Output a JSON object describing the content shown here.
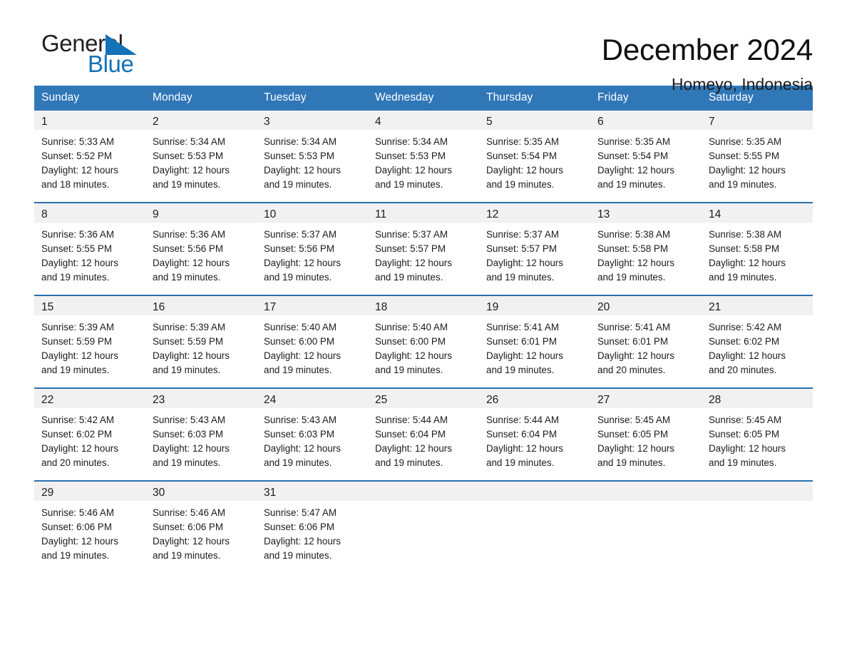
{
  "brand": {
    "logo_text_1": "General",
    "logo_text_2": "Blue",
    "logo_icon": "triangle-icon",
    "accent_color": "#1372b8",
    "header_color": "#3077b8",
    "daynum_band_color": "#f1f1f1"
  },
  "header": {
    "title": "December 2024",
    "location": "Homeyo, Indonesia"
  },
  "calendar": {
    "weekday_headers": [
      "Sunday",
      "Monday",
      "Tuesday",
      "Wednesday",
      "Thursday",
      "Friday",
      "Saturday"
    ],
    "weeks": [
      [
        {
          "day": "1",
          "sunrise": "Sunrise: 5:33 AM",
          "sunset": "Sunset: 5:52 PM",
          "daylight_line1": "Daylight: 12 hours",
          "daylight_line2": "and 18 minutes."
        },
        {
          "day": "2",
          "sunrise": "Sunrise: 5:34 AM",
          "sunset": "Sunset: 5:53 PM",
          "daylight_line1": "Daylight: 12 hours",
          "daylight_line2": "and 19 minutes."
        },
        {
          "day": "3",
          "sunrise": "Sunrise: 5:34 AM",
          "sunset": "Sunset: 5:53 PM",
          "daylight_line1": "Daylight: 12 hours",
          "daylight_line2": "and 19 minutes."
        },
        {
          "day": "4",
          "sunrise": "Sunrise: 5:34 AM",
          "sunset": "Sunset: 5:53 PM",
          "daylight_line1": "Daylight: 12 hours",
          "daylight_line2": "and 19 minutes."
        },
        {
          "day": "5",
          "sunrise": "Sunrise: 5:35 AM",
          "sunset": "Sunset: 5:54 PM",
          "daylight_line1": "Daylight: 12 hours",
          "daylight_line2": "and 19 minutes."
        },
        {
          "day": "6",
          "sunrise": "Sunrise: 5:35 AM",
          "sunset": "Sunset: 5:54 PM",
          "daylight_line1": "Daylight: 12 hours",
          "daylight_line2": "and 19 minutes."
        },
        {
          "day": "7",
          "sunrise": "Sunrise: 5:35 AM",
          "sunset": "Sunset: 5:55 PM",
          "daylight_line1": "Daylight: 12 hours",
          "daylight_line2": "and 19 minutes."
        }
      ],
      [
        {
          "day": "8",
          "sunrise": "Sunrise: 5:36 AM",
          "sunset": "Sunset: 5:55 PM",
          "daylight_line1": "Daylight: 12 hours",
          "daylight_line2": "and 19 minutes."
        },
        {
          "day": "9",
          "sunrise": "Sunrise: 5:36 AM",
          "sunset": "Sunset: 5:56 PM",
          "daylight_line1": "Daylight: 12 hours",
          "daylight_line2": "and 19 minutes."
        },
        {
          "day": "10",
          "sunrise": "Sunrise: 5:37 AM",
          "sunset": "Sunset: 5:56 PM",
          "daylight_line1": "Daylight: 12 hours",
          "daylight_line2": "and 19 minutes."
        },
        {
          "day": "11",
          "sunrise": "Sunrise: 5:37 AM",
          "sunset": "Sunset: 5:57 PM",
          "daylight_line1": "Daylight: 12 hours",
          "daylight_line2": "and 19 minutes."
        },
        {
          "day": "12",
          "sunrise": "Sunrise: 5:37 AM",
          "sunset": "Sunset: 5:57 PM",
          "daylight_line1": "Daylight: 12 hours",
          "daylight_line2": "and 19 minutes."
        },
        {
          "day": "13",
          "sunrise": "Sunrise: 5:38 AM",
          "sunset": "Sunset: 5:58 PM",
          "daylight_line1": "Daylight: 12 hours",
          "daylight_line2": "and 19 minutes."
        },
        {
          "day": "14",
          "sunrise": "Sunrise: 5:38 AM",
          "sunset": "Sunset: 5:58 PM",
          "daylight_line1": "Daylight: 12 hours",
          "daylight_line2": "and 19 minutes."
        }
      ],
      [
        {
          "day": "15",
          "sunrise": "Sunrise: 5:39 AM",
          "sunset": "Sunset: 5:59 PM",
          "daylight_line1": "Daylight: 12 hours",
          "daylight_line2": "and 19 minutes."
        },
        {
          "day": "16",
          "sunrise": "Sunrise: 5:39 AM",
          "sunset": "Sunset: 5:59 PM",
          "daylight_line1": "Daylight: 12 hours",
          "daylight_line2": "and 19 minutes."
        },
        {
          "day": "17",
          "sunrise": "Sunrise: 5:40 AM",
          "sunset": "Sunset: 6:00 PM",
          "daylight_line1": "Daylight: 12 hours",
          "daylight_line2": "and 19 minutes."
        },
        {
          "day": "18",
          "sunrise": "Sunrise: 5:40 AM",
          "sunset": "Sunset: 6:00 PM",
          "daylight_line1": "Daylight: 12 hours",
          "daylight_line2": "and 19 minutes."
        },
        {
          "day": "19",
          "sunrise": "Sunrise: 5:41 AM",
          "sunset": "Sunset: 6:01 PM",
          "daylight_line1": "Daylight: 12 hours",
          "daylight_line2": "and 19 minutes."
        },
        {
          "day": "20",
          "sunrise": "Sunrise: 5:41 AM",
          "sunset": "Sunset: 6:01 PM",
          "daylight_line1": "Daylight: 12 hours",
          "daylight_line2": "and 20 minutes."
        },
        {
          "day": "21",
          "sunrise": "Sunrise: 5:42 AM",
          "sunset": "Sunset: 6:02 PM",
          "daylight_line1": "Daylight: 12 hours",
          "daylight_line2": "and 20 minutes."
        }
      ],
      [
        {
          "day": "22",
          "sunrise": "Sunrise: 5:42 AM",
          "sunset": "Sunset: 6:02 PM",
          "daylight_line1": "Daylight: 12 hours",
          "daylight_line2": "and 20 minutes."
        },
        {
          "day": "23",
          "sunrise": "Sunrise: 5:43 AM",
          "sunset": "Sunset: 6:03 PM",
          "daylight_line1": "Daylight: 12 hours",
          "daylight_line2": "and 19 minutes."
        },
        {
          "day": "24",
          "sunrise": "Sunrise: 5:43 AM",
          "sunset": "Sunset: 6:03 PM",
          "daylight_line1": "Daylight: 12 hours",
          "daylight_line2": "and 19 minutes."
        },
        {
          "day": "25",
          "sunrise": "Sunrise: 5:44 AM",
          "sunset": "Sunset: 6:04 PM",
          "daylight_line1": "Daylight: 12 hours",
          "daylight_line2": "and 19 minutes."
        },
        {
          "day": "26",
          "sunrise": "Sunrise: 5:44 AM",
          "sunset": "Sunset: 6:04 PM",
          "daylight_line1": "Daylight: 12 hours",
          "daylight_line2": "and 19 minutes."
        },
        {
          "day": "27",
          "sunrise": "Sunrise: 5:45 AM",
          "sunset": "Sunset: 6:05 PM",
          "daylight_line1": "Daylight: 12 hours",
          "daylight_line2": "and 19 minutes."
        },
        {
          "day": "28",
          "sunrise": "Sunrise: 5:45 AM",
          "sunset": "Sunset: 6:05 PM",
          "daylight_line1": "Daylight: 12 hours",
          "daylight_line2": "and 19 minutes."
        }
      ],
      [
        {
          "day": "29",
          "sunrise": "Sunrise: 5:46 AM",
          "sunset": "Sunset: 6:06 PM",
          "daylight_line1": "Daylight: 12 hours",
          "daylight_line2": "and 19 minutes."
        },
        {
          "day": "30",
          "sunrise": "Sunrise: 5:46 AM",
          "sunset": "Sunset: 6:06 PM",
          "daylight_line1": "Daylight: 12 hours",
          "daylight_line2": "and 19 minutes."
        },
        {
          "day": "31",
          "sunrise": "Sunrise: 5:47 AM",
          "sunset": "Sunset: 6:06 PM",
          "daylight_line1": "Daylight: 12 hours",
          "daylight_line2": "and 19 minutes."
        },
        {
          "day": "",
          "sunrise": "",
          "sunset": "",
          "daylight_line1": "",
          "daylight_line2": ""
        },
        {
          "day": "",
          "sunrise": "",
          "sunset": "",
          "daylight_line1": "",
          "daylight_line2": ""
        },
        {
          "day": "",
          "sunrise": "",
          "sunset": "",
          "daylight_line1": "",
          "daylight_line2": ""
        },
        {
          "day": "",
          "sunrise": "",
          "sunset": "",
          "daylight_line1": "",
          "daylight_line2": ""
        }
      ]
    ]
  }
}
